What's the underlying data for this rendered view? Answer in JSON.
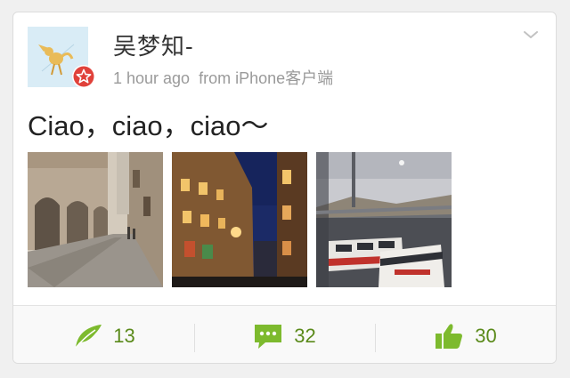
{
  "post": {
    "username": "吴梦知-",
    "time": "1 hour ago",
    "source": "from iPhone客户端",
    "text": "Ciao，ciao，ciao～",
    "photos": [
      "street-arcade-photo",
      "night-street-photo",
      "bus-window-photo"
    ]
  },
  "actions": {
    "repost_count": "13",
    "comment_count": "32",
    "like_count": "30"
  },
  "colors": {
    "accent_green": "#7dba2e",
    "count_green": "#5a8a1a",
    "badge_red": "#e0413a"
  }
}
